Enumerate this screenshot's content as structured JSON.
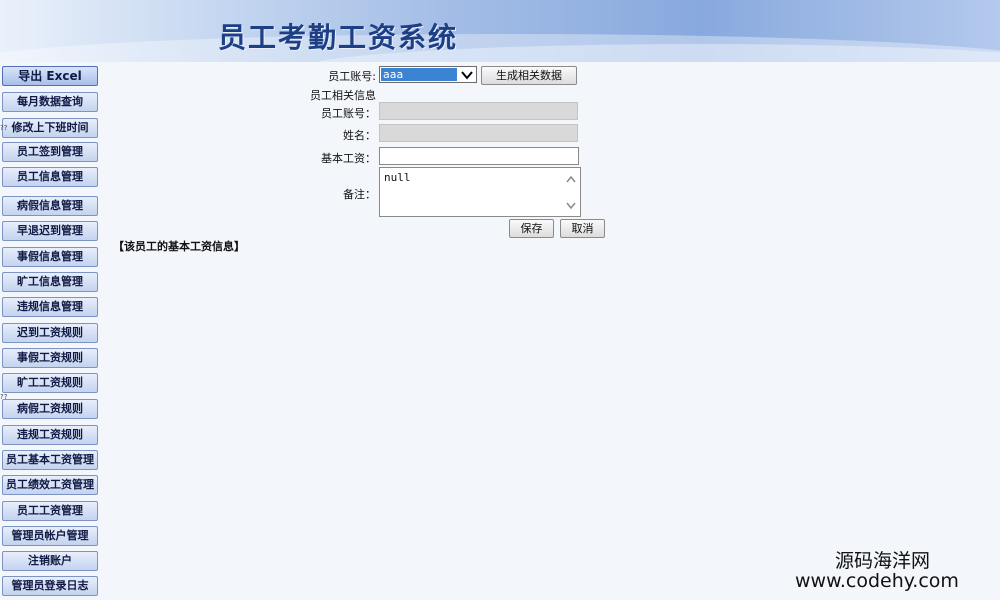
{
  "header": {
    "title": "员工考勤工资系统"
  },
  "sidebar": {
    "items": [
      {
        "label": "导出 Excel"
      },
      {
        "label": "每月数据查询"
      },
      {
        "label": "修改上下班时间"
      },
      {
        "label": "员工签到管理"
      },
      {
        "label": "员工信息管理"
      },
      {
        "label": "病假信息管理"
      },
      {
        "label": "早退迟到管理"
      },
      {
        "label": "事假信息管理"
      },
      {
        "label": "旷工信息管理"
      },
      {
        "label": "违规信息管理"
      },
      {
        "label": "迟到工资规则"
      },
      {
        "label": "事假工资规则"
      },
      {
        "label": "旷工工资规则"
      },
      {
        "label": "病假工资规则"
      },
      {
        "label": "违规工资规则"
      },
      {
        "label": "员工基本工资管理"
      },
      {
        "label": "员工绩效工资管理"
      },
      {
        "label": "员工工资管理"
      },
      {
        "label": "管理员帐户管理"
      },
      {
        "label": "注销账户"
      },
      {
        "label": "管理员登录日志"
      }
    ],
    "markers": [
      "??",
      "??"
    ]
  },
  "form": {
    "account_select_label": "员工账号:",
    "account_select_value": "aaa",
    "generate_button": "生成相关数据",
    "section_heading": "员工相关信息",
    "account_label": "员工账号：",
    "account_value": "",
    "name_label": "姓名：",
    "name_value": "",
    "base_salary_label": "基本工资：",
    "base_salary_value": "",
    "remark_label": "备注：",
    "remark_value": "null",
    "save_button": "保存",
    "cancel_button": "取消"
  },
  "section_note": "【该员工的基本工资信息】",
  "watermark": {
    "line1": "源码海洋网",
    "line2": "www.codehy.com"
  },
  "icons": {
    "select_arrow": "chevron-down-icon",
    "scroll_up": "chevron-up-icon",
    "scroll_down": "chevron-down-icon"
  }
}
